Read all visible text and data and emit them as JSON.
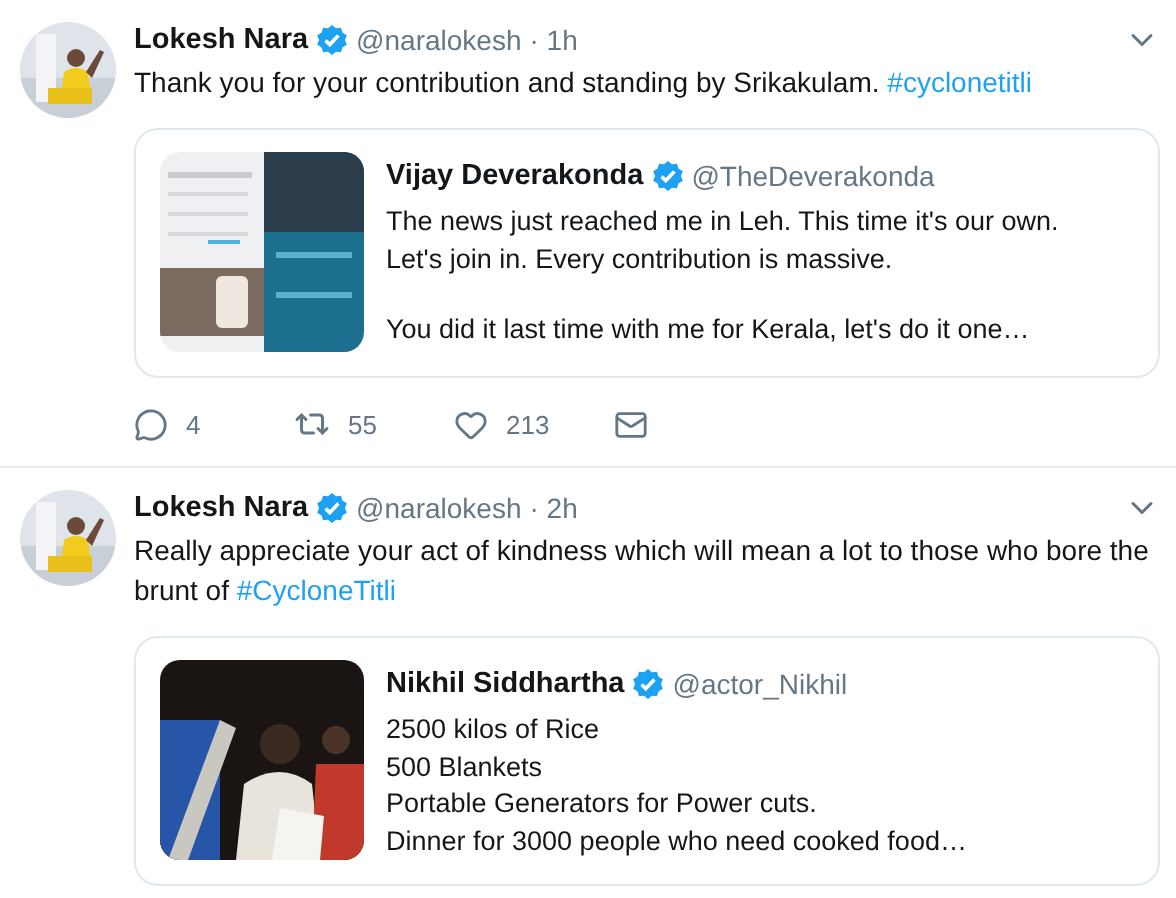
{
  "tweets": [
    {
      "author": "Lokesh Nara",
      "verified": true,
      "handle": "@naralokesh",
      "time": "· 1h",
      "text": "Thank you for your contribution and standing by Srikakulam. ",
      "hashtag": "#cyclonetitli",
      "quote": {
        "author": "Vijay Deverakonda",
        "verified": true,
        "handle": "@TheDeverakonda",
        "paragraphs": [
          [
            "The news just reached me in Leh. This time it's our own.",
            "Let's join in. Every contribution is massive."
          ],
          [
            "You did it last time with me for Kerala, let's do it one…"
          ]
        ]
      },
      "actions": {
        "replies": "4",
        "retweets": "55",
        "likes": "213"
      }
    },
    {
      "author": "Lokesh Nara",
      "verified": true,
      "handle": "@naralokesh",
      "time": "· 2h",
      "text": "Really appreciate your act of kindness which will mean a lot to those who bore the brunt of ",
      "hashtag": "#CycloneTitli",
      "quote": {
        "author": "Nikhil Siddhartha",
        "verified": true,
        "handle": "@actor_Nikhil",
        "paragraphs": [
          [
            "2500 kilos of Rice",
            "500 Blankets",
            "Portable Generators for Power cuts.",
            "Dinner for 3000 people who need cooked food…"
          ]
        ]
      }
    }
  ]
}
